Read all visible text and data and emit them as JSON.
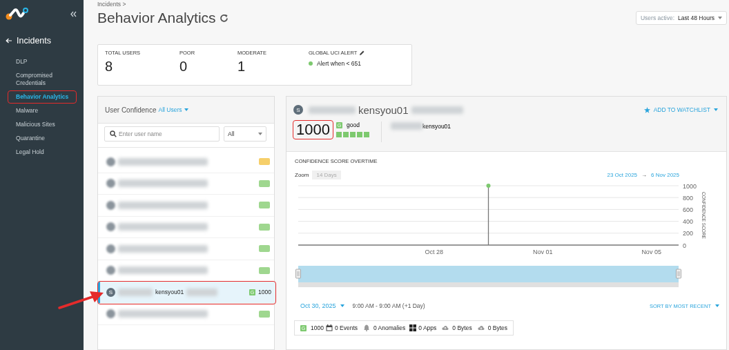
{
  "sidebar": {
    "back_label": "Incidents",
    "items": [
      {
        "label": "DLP",
        "selected": false,
        "highlighted": false
      },
      {
        "label": "Compromised Credentials",
        "selected": false,
        "highlighted": false
      },
      {
        "label": "Behavior Analytics",
        "selected": true,
        "highlighted": true
      },
      {
        "label": "Malware",
        "selected": false,
        "highlighted": false
      },
      {
        "label": "Malicious Sites",
        "selected": false,
        "highlighted": false
      },
      {
        "label": "Quarantine",
        "selected": false,
        "highlighted": false
      },
      {
        "label": "Legal Hold",
        "selected": false,
        "highlighted": false
      }
    ]
  },
  "breadcrumb": "Incidents >",
  "title": "Behavior Analytics",
  "users_active": {
    "label": "Users active:",
    "value": "Last 48 Hours"
  },
  "stats": [
    {
      "label": "TOTAL USERS",
      "value": "8"
    },
    {
      "label": "POOR",
      "value": "0"
    },
    {
      "label": "MODERATE",
      "value": "1"
    }
  ],
  "global_alert": {
    "label": "GLOBAL UCI ALERT",
    "text": "Alert when < 651",
    "color": "#7dc96f"
  },
  "user_list": {
    "title": "User Confidence",
    "filter": "All Users",
    "search_placeholder": "Enter user name",
    "select": "All",
    "items": [
      {
        "kind": "redacted",
        "selected": false,
        "color": "#f6cf6a"
      },
      {
        "kind": "redacted",
        "selected": false,
        "color": "#9fd78f"
      },
      {
        "kind": "redacted",
        "selected": false,
        "color": "#9fd78f"
      },
      {
        "kind": "redacted",
        "selected": false,
        "color": "#9fd78f"
      },
      {
        "kind": "redacted",
        "selected": false,
        "color": "#9fd78f"
      },
      {
        "kind": "redacted",
        "selected": false,
        "color": "#9fd78f"
      },
      {
        "kind": "user",
        "selected": true,
        "highlighted": true,
        "avatar": "S",
        "name": "kensyou01",
        "grade": "G",
        "score": "1000",
        "color": "#7dc96f"
      },
      {
        "kind": "redacted",
        "selected": false,
        "color": "#9fd78f"
      }
    ]
  },
  "detail": {
    "avatar": "S",
    "name": "kensyou01",
    "watchlist": "ADD TO WATCHLIST",
    "score": "1000",
    "score_highlighted": true,
    "grade": "G",
    "rating": "good",
    "stars": 5,
    "account": "kensyou01",
    "chart_title": "CONFIDENCE SCORE OVERTIME",
    "zoom_label": "Zoom",
    "zoom_button": "14 Days",
    "range_from": "23 Oct 2025",
    "range_arrow": "→",
    "range_to": "6 Nov 2025",
    "chart_data": {
      "type": "scatter",
      "ylabel": "CONFIDENCE SCORE",
      "categories": [
        null,
        null,
        null,
        null,
        null,
        "Oct 28",
        null,
        null,
        null,
        "Nov 01",
        null,
        null,
        null,
        "Nov 05",
        null
      ],
      "series": [
        {
          "color": "#7dc96f",
          "values": [
            null,
            null,
            null,
            null,
            null,
            null,
            null,
            1000,
            null,
            null,
            null,
            null,
            null,
            null,
            null
          ]
        }
      ],
      "ylim": [
        0,
        1000
      ],
      "yticks": [
        0,
        200,
        400,
        600,
        800,
        1000
      ],
      "grid": true
    },
    "date": "Oct 30, 2025",
    "time_range": "9:00 AM - 9:00 AM (+1 Day)",
    "sort": "SORT BY MOST RECENT",
    "summary": [
      {
        "kind": "score",
        "grade": "G",
        "text": "1000"
      },
      {
        "kind": "events",
        "text": "0 Events"
      },
      {
        "kind": "anomalies",
        "text": "0 Anomalies"
      },
      {
        "kind": "apps",
        "text": "0 Apps"
      },
      {
        "kind": "upload",
        "text": "0 Bytes"
      },
      {
        "kind": "download",
        "text": "0 Bytes"
      }
    ]
  },
  "annotation": {
    "arrow": true
  }
}
